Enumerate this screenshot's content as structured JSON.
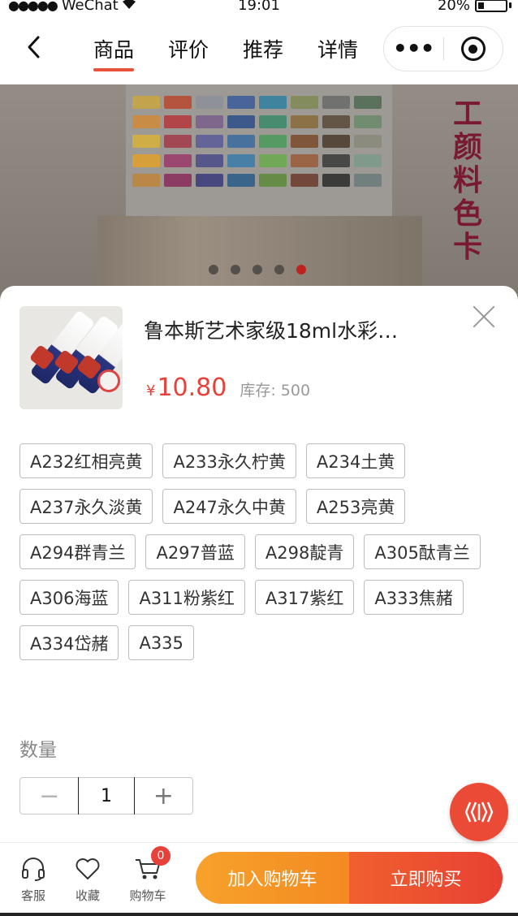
{
  "status_bar": {
    "carrier": "WeChat",
    "time": "19:01",
    "battery": "20%"
  },
  "nav": {
    "tabs": [
      {
        "label": "商品",
        "active": true
      },
      {
        "label": "评价",
        "active": false
      },
      {
        "label": "推荐",
        "active": false
      },
      {
        "label": "详情",
        "active": false
      }
    ]
  },
  "banner": {
    "side_text": "工颜料色卡",
    "slide_count": 5,
    "active_slide": 5
  },
  "product": {
    "title": "鲁本斯艺术家级18ml水彩…",
    "currency": "¥",
    "price": "10.80",
    "stock": "库存: 500"
  },
  "options": [
    "A232红相亮黄",
    "A233永久柠黄",
    "A234土黄",
    "A237永久淡黄",
    "A247永久中黄",
    "A253亮黄",
    "A294群青兰",
    "A297普蓝",
    "A298靛青",
    "A305酞青兰",
    "A306海蓝",
    "A311粉紫红",
    "A317紫红",
    "A333焦赭",
    "A334岱赭",
    "A335"
  ],
  "quantity": {
    "label": "数量",
    "value": "1",
    "minus": "−",
    "plus": "+"
  },
  "bottom_bar": {
    "service": "客服",
    "favorite": "收藏",
    "cart": "购物车",
    "cart_badge": "0",
    "add_to_cart": "加入购物车",
    "buy_now": "立即购买"
  },
  "colors": {
    "accent": "#e8413a",
    "cart_button": "#f7a12a",
    "buy_button": "#e84033"
  }
}
